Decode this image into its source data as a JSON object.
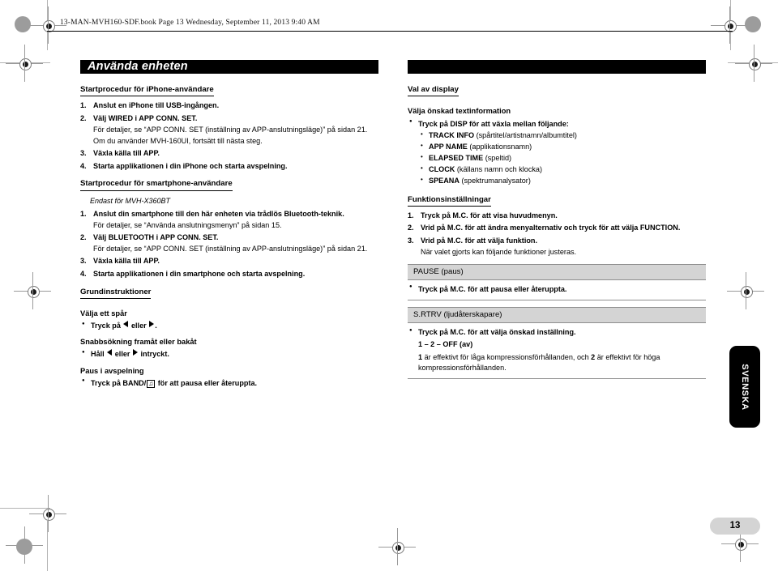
{
  "running_head": "13-MAN-MVH160-SDF.book  Page 13  Wednesday, September 11, 2013  9:40 AM",
  "page_number": "13",
  "language_tab": "SVENSKA",
  "colors": {
    "banner_bg": "#000000",
    "funcbox_bg": "#d4d4d4",
    "pagenum_bg": "#d4d4d4",
    "text": "#000000"
  },
  "left_column": {
    "banner_title": "Använda enheten",
    "sections": [
      {
        "heading": "Startprocedur för iPhone-användare",
        "steps": [
          {
            "num": "1.",
            "text": "Anslut en iPhone till USB-ingången.",
            "detail": ""
          },
          {
            "num": "2.",
            "text": "Välj WIRED i APP CONN. SET.",
            "detail": "För detaljer, se “APP CONN. SET (inställning av APP-anslutningsläge)” på sidan 21.",
            "detail2": "Om du använder MVH-160UI, fortsätt till nästa steg."
          },
          {
            "num": "3.",
            "text": "Växla källa till APP.",
            "detail": ""
          },
          {
            "num": "4.",
            "text": "Starta applikationen i din iPhone och starta avspelning.",
            "detail": ""
          }
        ]
      },
      {
        "heading": "Startprocedur för smartphone-användare",
        "note": "Endast för MVH-X360BT",
        "steps": [
          {
            "num": "1.",
            "text": "Anslut din smartphone till den här enheten via trådlös Bluetooth-teknik.",
            "detail": "För detaljer, se “Använda anslutningsmenyn” på sidan 15."
          },
          {
            "num": "2.",
            "text": "Välj BLUETOOTH i APP CONN. SET.",
            "detail": "För detaljer, se “APP CONN. SET (inställning av APP-anslutningsläge)” på sidan 21."
          },
          {
            "num": "3.",
            "text": "Växla källa till APP.",
            "detail": ""
          },
          {
            "num": "4.",
            "text": "Starta applikationen i din smartphone och starta avspelning.",
            "detail": ""
          }
        ]
      },
      {
        "heading": "Grundinstruktioner",
        "subsections": [
          {
            "title": "Välja ett spår",
            "bullet_pre": "Tryck på ",
            "bullet_mid": " eller ",
            "bullet_post": "."
          },
          {
            "title": "Snabbsökning framåt eller bakåt",
            "bullet_pre": "Håll ",
            "bullet_mid": " eller ",
            "bullet_post": " intryckt."
          },
          {
            "title": "Paus i avspelning",
            "bullet_pre": "Tryck på BAND/",
            "bullet_post": " för att pausa eller återuppta."
          }
        ]
      }
    ]
  },
  "right_column": {
    "banner_title": "",
    "sections": [
      {
        "heading": "Val av display",
        "subtitle": "Välja önskad textinformation",
        "bullet": "Tryck på DISP för att växla mellan följande:",
        "options": [
          {
            "name": "TRACK INFO",
            "desc": "(spårtitel/artistnamn/albumtitel)"
          },
          {
            "name": "APP NAME",
            "desc": "(applikationsnamn)"
          },
          {
            "name": "ELAPSED TIME",
            "desc": "(speltid)"
          },
          {
            "name": "CLOCK",
            "desc": "(källans namn och klocka)"
          },
          {
            "name": "SPEANA",
            "desc": "(spektrumanalysator)"
          }
        ]
      },
      {
        "heading": "Funktionsinställningar",
        "steps": [
          {
            "num": "1.",
            "text": "Tryck på M.C. för att visa huvudmenyn.",
            "detail": ""
          },
          {
            "num": "2.",
            "text": "Vrid på M.C. för att ändra menyalternativ och tryck för att välja FUNCTION.",
            "detail": ""
          },
          {
            "num": "3.",
            "text": "Vrid på M.C. för att välja funktion.",
            "detail": "När valet gjorts kan följande funktioner justeras."
          }
        ],
        "functions": [
          {
            "title": "PAUSE (paus)",
            "bullet": "Tryck på M.C. för att pausa eller återuppta.",
            "values": "",
            "explanation": ""
          },
          {
            "title": "S.RTRV (ljudåterskapare)",
            "bullet": "Tryck på M.C. för att välja önskad inställning.",
            "values": "1 – 2 – OFF (av)",
            "explanation_pre": "1",
            "explanation_mid": " är effektivt för låga kompressionsförhållanden, och ",
            "explanation_bold2": "2",
            "explanation_post": " är effektivt för höga kompressionsförhållanden."
          }
        ]
      }
    ]
  }
}
